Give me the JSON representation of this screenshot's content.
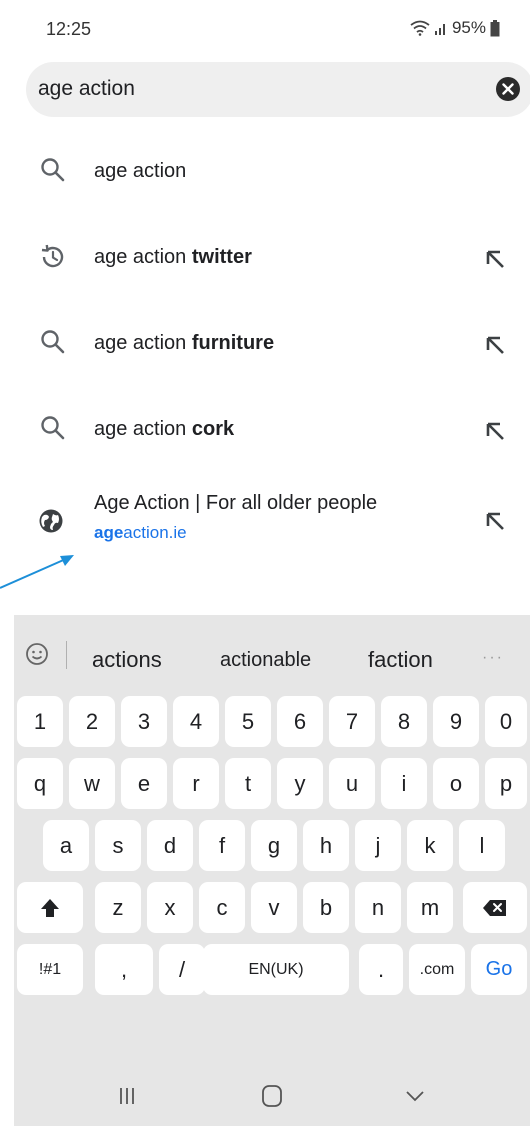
{
  "status_bar": {
    "time": "12:25",
    "battery": "95%"
  },
  "search": {
    "value": "age action"
  },
  "suggestions": [
    {
      "prefix": "age action",
      "bold": "",
      "icon": "search-icon",
      "has_arrow": false
    },
    {
      "prefix": "age action ",
      "bold": "twitter",
      "icon": "history-icon",
      "has_arrow": true
    },
    {
      "prefix": "age action ",
      "bold": "furniture",
      "icon": "search-icon",
      "has_arrow": true
    },
    {
      "prefix": "age action ",
      "bold": "cork",
      "icon": "search-icon",
      "has_arrow": true
    }
  ],
  "site_suggestion": {
    "title": "Age Action | For all older people",
    "url_bold": "age",
    "url_rest": "action.ie",
    "icon": "globe-icon"
  },
  "keyboard": {
    "suggestions": [
      "actions",
      "actionable",
      "faction"
    ],
    "more": "···",
    "rows": {
      "numbers": [
        "1",
        "2",
        "3",
        "4",
        "5",
        "6",
        "7",
        "8",
        "9",
        "0"
      ],
      "row1": [
        "q",
        "w",
        "e",
        "r",
        "t",
        "y",
        "u",
        "i",
        "o",
        "p"
      ],
      "row2": [
        "a",
        "s",
        "d",
        "f",
        "g",
        "h",
        "j",
        "k",
        "l"
      ],
      "row3": [
        "z",
        "x",
        "c",
        "v",
        "b",
        "n",
        "m"
      ]
    },
    "symbols_key": "!#1",
    "comma_key": ",",
    "slash_key": "/",
    "space_key": "EN(UK)",
    "period_key": ".",
    "dotcom_key": ".com",
    "go_key": "Go"
  },
  "colors": {
    "accent": "#1a73e8",
    "keyboard_bg": "#e6e6e6",
    "search_bg": "#efefef",
    "annotation": "#1d8fd8"
  }
}
